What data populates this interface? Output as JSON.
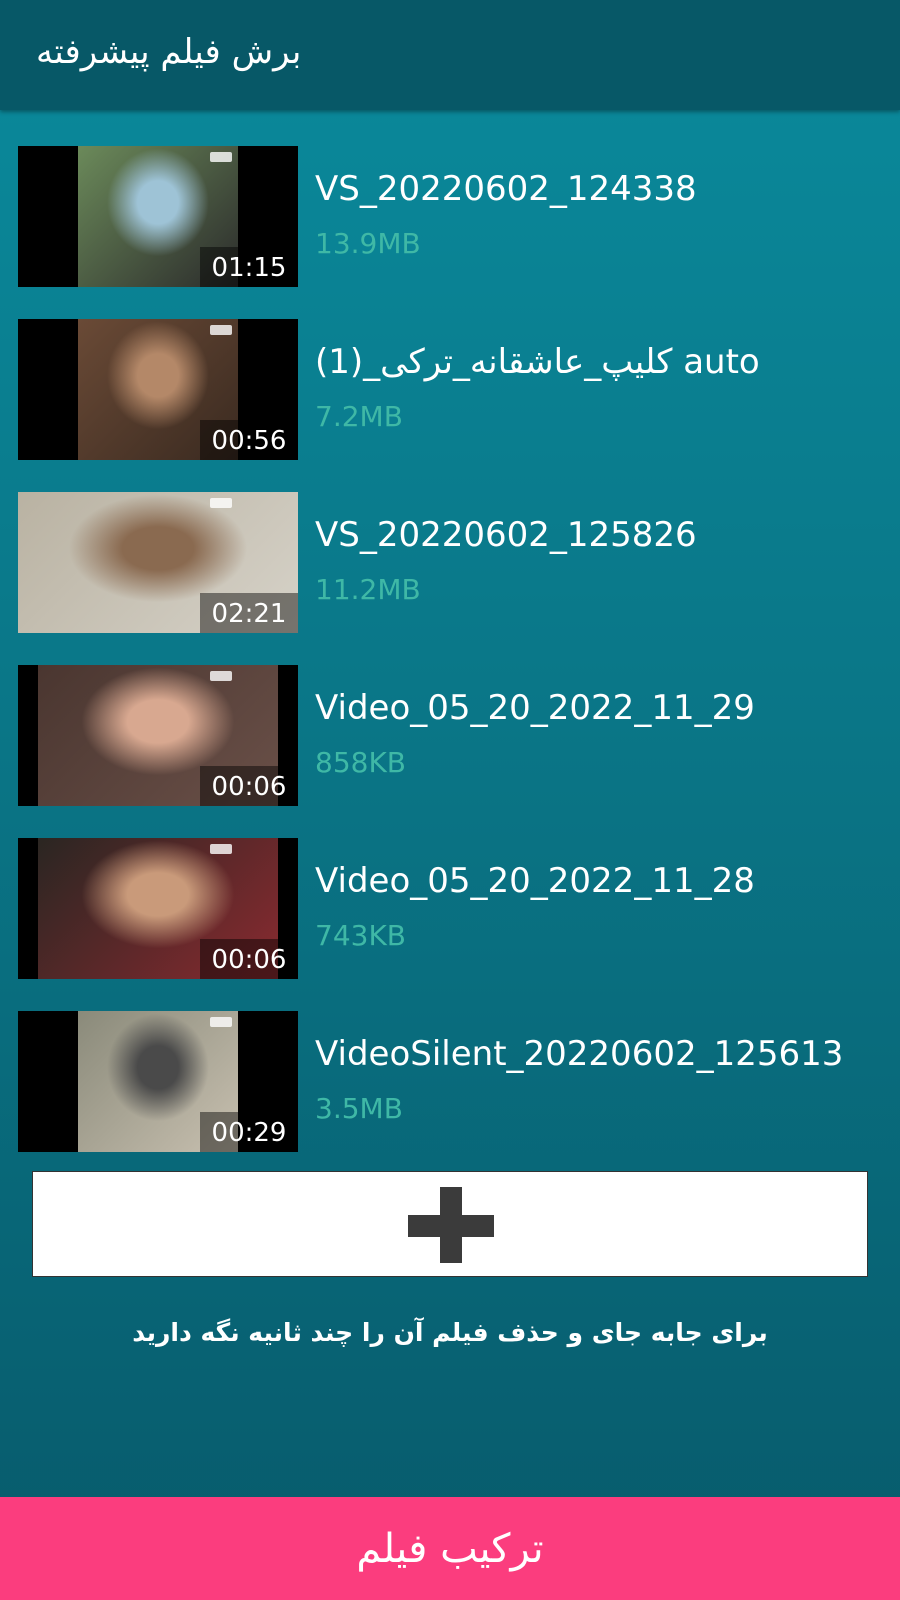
{
  "header": {
    "title": "برش فیلم پیشرفته"
  },
  "videos": [
    {
      "name": "VS_20220602_124338",
      "size": "13.9MB",
      "duration": "01:15",
      "thumb_colors": [
        "#6b8a5a",
        "#9ec3d6",
        "#2b2b2b"
      ],
      "layout": "pillar"
    },
    {
      "name": "کلیپ_عاشقانه_ترکی_(1) auto",
      "size": "7.2MB",
      "duration": "00:56",
      "thumb_colors": [
        "#6a4a36",
        "#b48868",
        "#3a2a20"
      ],
      "layout": "pillar"
    },
    {
      "name": "VS_20220602_125826",
      "size": "11.2MB",
      "duration": "02:21",
      "thumb_colors": [
        "#b9b2a2",
        "#8a6a50",
        "#d6d2c8"
      ],
      "layout": "wide"
    },
    {
      "name": "Video_05_20_2022_11_29",
      "size": "858KB",
      "duration": "00:06",
      "thumb_colors": [
        "#4a3630",
        "#d8a890",
        "#6a5048"
      ],
      "layout": "full"
    },
    {
      "name": "Video_05_20_2022_11_28",
      "size": "743KB",
      "duration": "00:06",
      "thumb_colors": [
        "#2a2622",
        "#c99a7a",
        "#8a2a30"
      ],
      "layout": "full"
    },
    {
      "name": "VideoSilent_20220602_125613",
      "size": "3.5MB",
      "duration": "00:29",
      "thumb_colors": [
        "#8a8a7a",
        "#4a4a4a",
        "#c8c0b0"
      ],
      "layout": "pillar"
    }
  ],
  "add_button": {
    "icon": "plus-icon"
  },
  "hint": "برای جابه جای و حذف فیلم آن را چند ثانیه نگه دارید",
  "merge_button": {
    "label": "ترکیب فیلم"
  },
  "colors": {
    "header": "#075867",
    "background_top": "#0a8a9c",
    "background_bottom": "#075a6b",
    "size_text": "#3fb8a6",
    "accent": "#fb3d7e"
  }
}
